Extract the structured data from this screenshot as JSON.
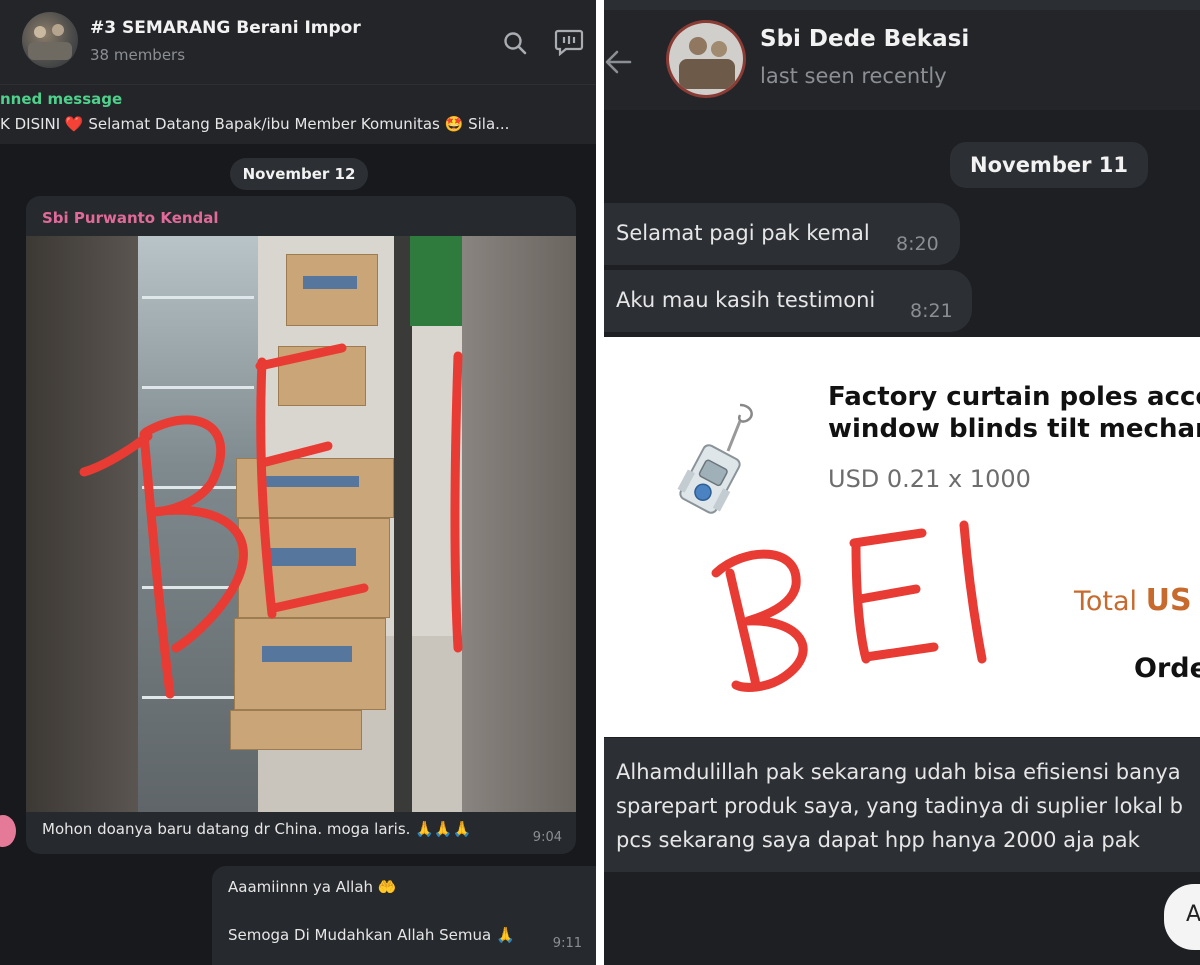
{
  "left_chat": {
    "group_title": "#3 SEMARANG Berani Impor",
    "members": "38 members",
    "pinned_label": "nned message",
    "pinned_text": "K DISINI ❤️  Selamat Datang Bapak/ibu Member Komunitas 🤩  Sila...",
    "date": "November 12",
    "message": {
      "sender": "Sbi Purwanto Kendal",
      "watermark": "BEI",
      "caption": "Mohon doanya baru datang dr China. moga laris. 🙏🙏🙏",
      "time": "9:04"
    },
    "reply": {
      "line1": "Aaamiinnn ya Allah 🤲",
      "line2": "Semoga Di Mudahkan Allah Semua 🙏",
      "time": "9:11"
    }
  },
  "right_chat": {
    "contact_name": "Sbi Dede Bekasi",
    "status": "last seen recently",
    "date": "November 11",
    "messages": [
      {
        "text": "Selamat pagi pak kemal",
        "time": "8:20"
      },
      {
        "text": "Aku mau kasih testimoni",
        "time": "8:21"
      }
    ],
    "order_card": {
      "product_line1": "Factory curtain poles accesso",
      "product_line2": "window blinds tilt mechanism",
      "price": "USD 0.21 x 1000",
      "total_label": "Total",
      "total_currency": "US",
      "order_label": "Orde",
      "watermark": "BEI"
    },
    "testimony": {
      "line1": "Alhamdulillah pak sekarang udah bisa efisiensi banya",
      "line2": "sparepart produk saya, yang tadinya di suplier lokal b",
      "line3": "pcs sekarang saya dapat hpp hanya 2000 aja pak"
    },
    "outgoing_partial": "A"
  }
}
